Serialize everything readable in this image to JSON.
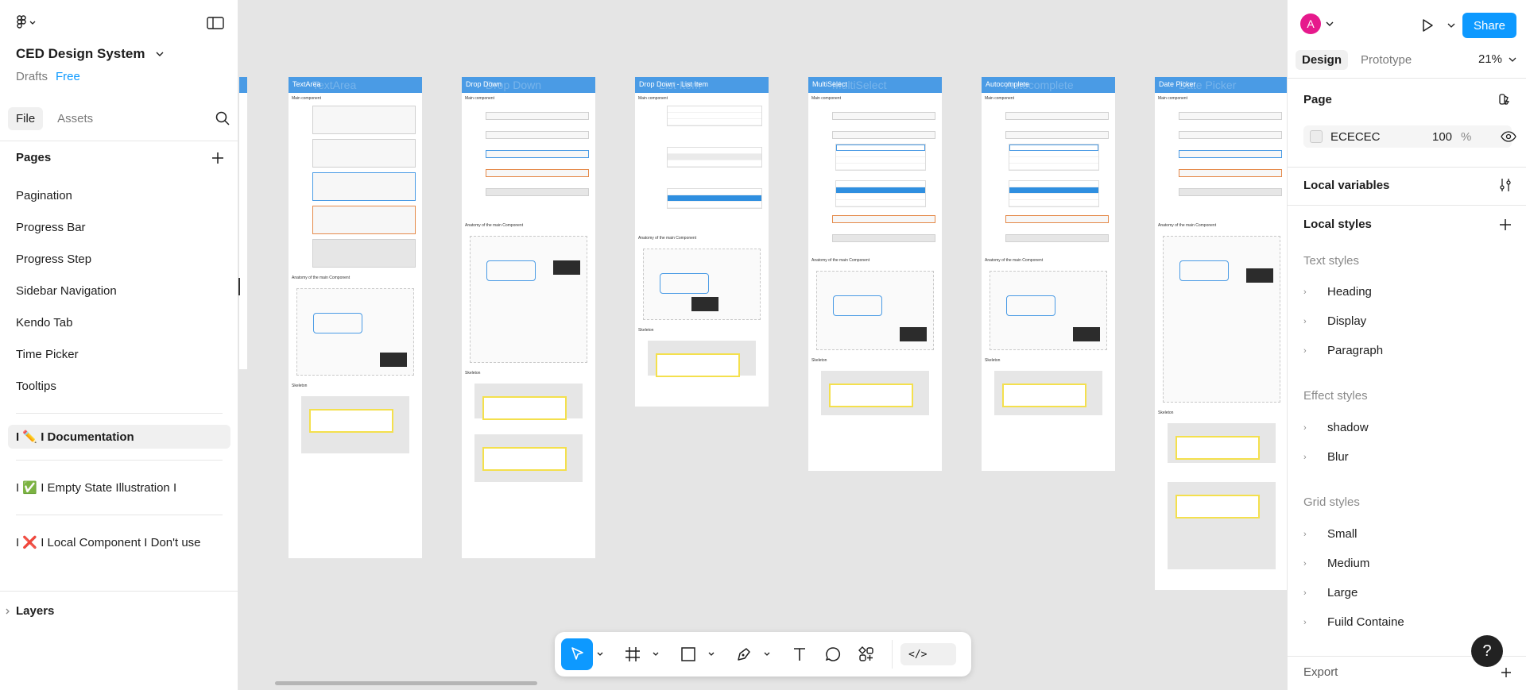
{
  "left": {
    "file_name": "CED Design System",
    "project": "Drafts",
    "plan": "Free",
    "tabs": [
      "File",
      "Assets"
    ],
    "pages_title": "Pages",
    "pages": [
      "Pagination",
      "Progress Bar",
      "Progress Step",
      "Sidebar Navigation",
      "Kendo Tab",
      "Time Picker",
      "Tooltips"
    ],
    "special_pages": [
      {
        "prefix": "I",
        "emoji": "✏️",
        "label": "I Documentation",
        "selected": true
      },
      {
        "prefix": "I",
        "emoji": "✅",
        "label": "I Empty State Illustration I",
        "selected": false
      },
      {
        "prefix": "I",
        "emoji": "❌",
        "label": "I Local Component I Don't use",
        "selected": false
      }
    ],
    "layers_title": "Layers"
  },
  "canvas": {
    "frames": [
      {
        "title": "TextArea",
        "ghost": "TextArea"
      },
      {
        "title": "Drop Down",
        "ghost": "Drop Down"
      },
      {
        "title": "Drop Down - List Item",
        "ghost": "List Item"
      },
      {
        "title": "MultiSelect",
        "ghost": "MultiSelect"
      },
      {
        "title": "Autocomplete",
        "ghost": "Autocomplete"
      },
      {
        "title": "Date Picker",
        "ghost": "Date Picker"
      }
    ],
    "section_main": "Main component",
    "section_anatomy": "Anatomy of the main Component",
    "section_skeleton": "Skeleton"
  },
  "toolbar": {
    "tools": [
      "move-tool",
      "frame-tool",
      "shape-tool",
      "pen-tool",
      "text-tool",
      "comment-tool",
      "actions-tool"
    ],
    "dev_mode": "</>"
  },
  "right": {
    "avatar_letter": "A",
    "share_label": "Share",
    "tabs": [
      "Design",
      "Prototype"
    ],
    "zoom": "21%",
    "page_title": "Page",
    "page_color": "ECECEC",
    "page_opacity": "100",
    "percent": "%",
    "local_variables": "Local variables",
    "local_styles": "Local styles",
    "text_styles_title": "Text styles",
    "text_styles": [
      "Heading",
      "Display",
      "Paragraph"
    ],
    "effect_styles_title": "Effect styles",
    "effect_styles": [
      "shadow",
      "Blur"
    ],
    "grid_styles_title": "Grid styles",
    "grid_styles": [
      "Small",
      "Medium",
      "Large",
      "Fuild Containe"
    ],
    "export": "Export",
    "help": "?"
  },
  "colors": {
    "accent": "#0d99ff",
    "frame_header": "#4a9be5",
    "avatar": "#e6198c"
  }
}
